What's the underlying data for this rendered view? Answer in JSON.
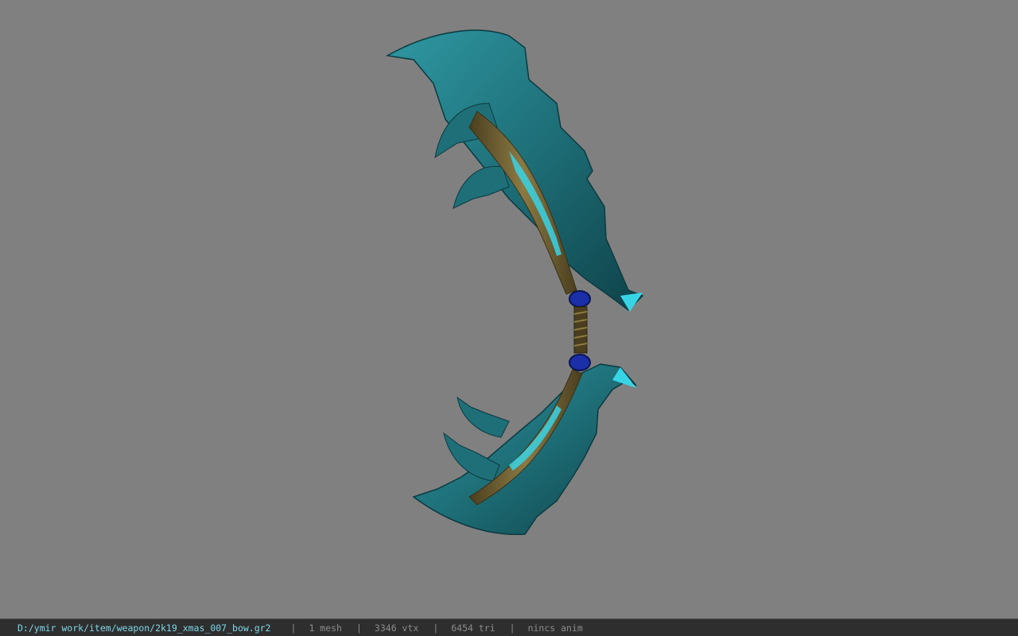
{
  "viewport": {
    "background": "#808080",
    "model_name": "2k19_xmas_007_bow",
    "palette": {
      "blade": "#1e6f78",
      "blade_dark": "#0f4249",
      "blade_light": "#2f98a3",
      "glow": "#37d4e6",
      "gold": "#7a6a3a",
      "gold_dark": "#4a3e1e",
      "gem": "#1a2fa8"
    }
  },
  "statusbar": {
    "path": "D:/ymir work/item/weapon/2k19_xmas_007_bow.gr2",
    "separator": "|",
    "mesh": "1 mesh",
    "vertices": "3346 vtx",
    "triangles": "6454 tri",
    "anim": "nincs anim"
  }
}
